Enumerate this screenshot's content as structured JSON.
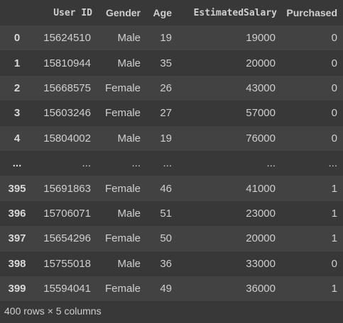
{
  "table": {
    "columns": [
      "User ID",
      "Gender",
      "Age",
      "EstimatedSalary",
      "Purchased"
    ],
    "rows": [
      {
        "index": "0",
        "cells": [
          "15624510",
          "Male",
          "19",
          "19000",
          "0"
        ]
      },
      {
        "index": "1",
        "cells": [
          "15810944",
          "Male",
          "35",
          "20000",
          "0"
        ]
      },
      {
        "index": "2",
        "cells": [
          "15668575",
          "Female",
          "26",
          "43000",
          "0"
        ]
      },
      {
        "index": "3",
        "cells": [
          "15603246",
          "Female",
          "27",
          "57000",
          "0"
        ]
      },
      {
        "index": "4",
        "cells": [
          "15804002",
          "Male",
          "19",
          "76000",
          "0"
        ]
      },
      {
        "index": "...",
        "cells": [
          "...",
          "...",
          "...",
          "...",
          "..."
        ]
      },
      {
        "index": "395",
        "cells": [
          "15691863",
          "Female",
          "46",
          "41000",
          "1"
        ]
      },
      {
        "index": "396",
        "cells": [
          "15706071",
          "Male",
          "51",
          "23000",
          "1"
        ]
      },
      {
        "index": "397",
        "cells": [
          "15654296",
          "Female",
          "50",
          "20000",
          "1"
        ]
      },
      {
        "index": "398",
        "cells": [
          "15755018",
          "Male",
          "36",
          "33000",
          "0"
        ]
      },
      {
        "index": "399",
        "cells": [
          "15594041",
          "Female",
          "49",
          "36000",
          "1"
        ]
      }
    ],
    "footer": "400 rows × 5 columns"
  },
  "colors": {
    "background": "#383838",
    "row_stripe": "#424242",
    "text": "#cfcfcf"
  }
}
